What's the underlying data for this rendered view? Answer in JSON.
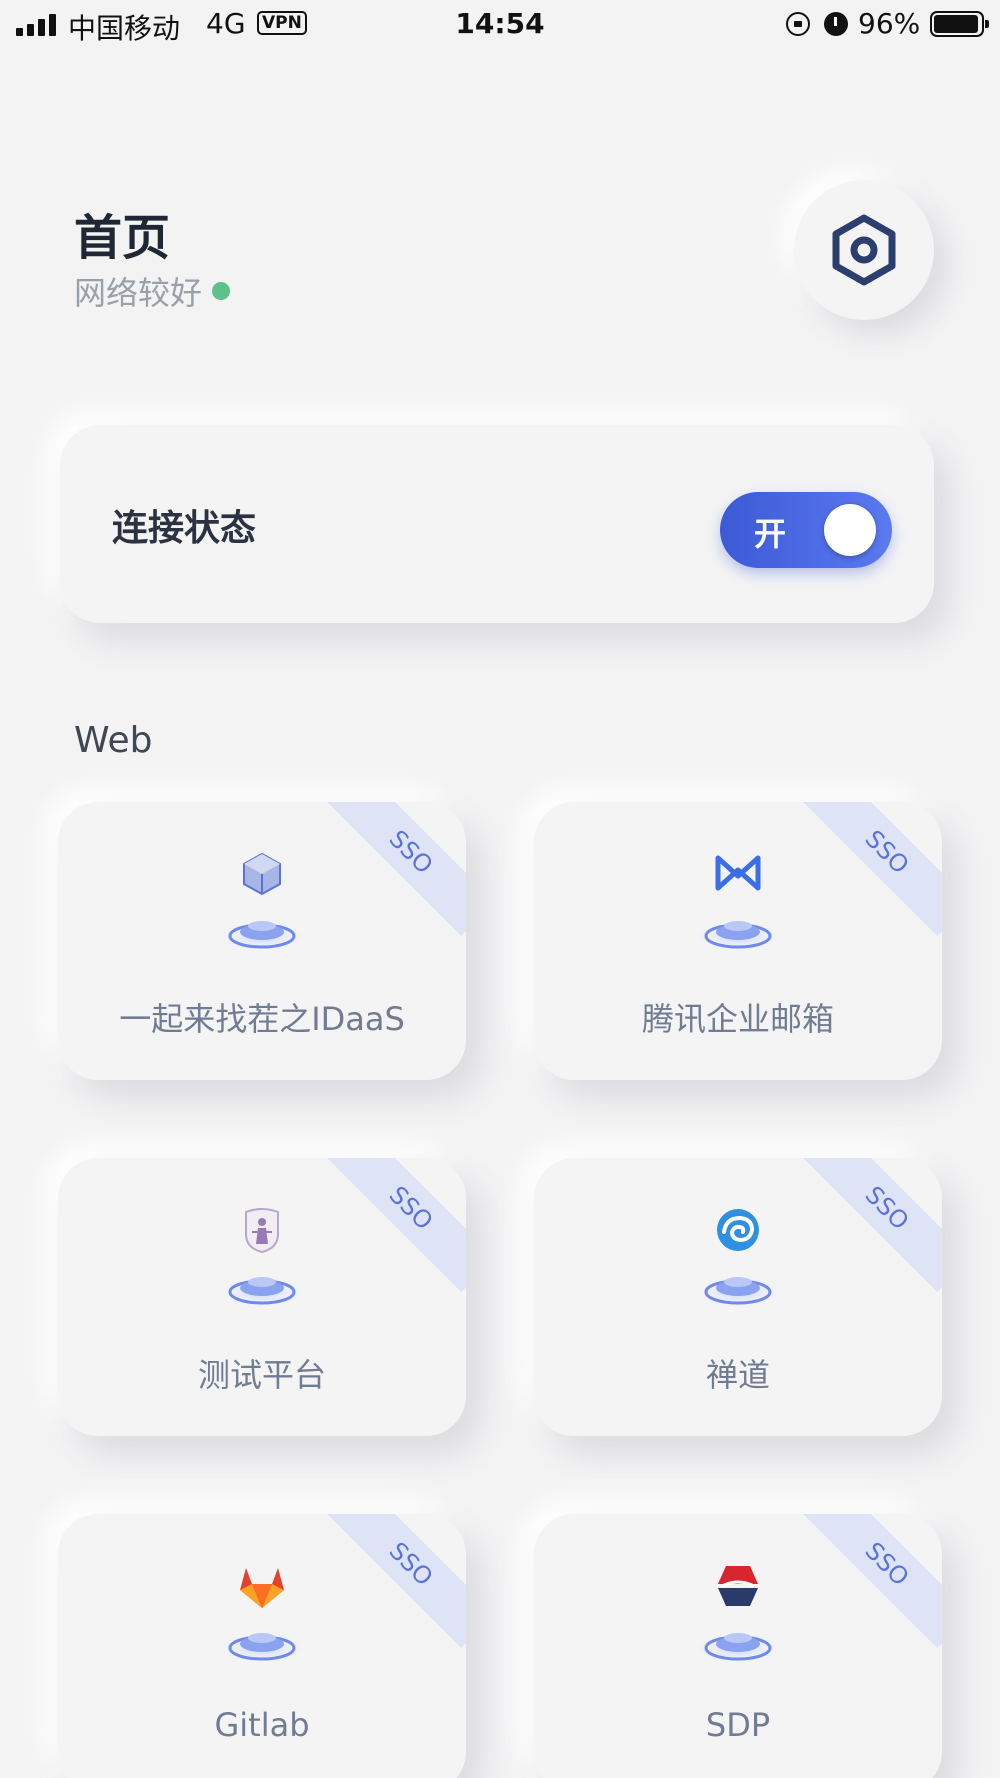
{
  "status_bar": {
    "carrier": "中国移动",
    "network_type": "4G",
    "vpn_label": "VPN",
    "time": "14:54",
    "battery_percent": "96%",
    "battery_level": 0.96
  },
  "header": {
    "title": "首页",
    "network_status": "网络较好",
    "settings_icon": "hexagon-gear-icon"
  },
  "connection": {
    "label": "连接状态",
    "toggle_text": "开",
    "enabled": true
  },
  "section": {
    "title": "Web"
  },
  "apps": [
    {
      "name": "一起来找茬之IDaaS",
      "badge": "SSO",
      "icon": "cube-icon"
    },
    {
      "name": "腾讯企业邮箱",
      "badge": "SSO",
      "icon": "tencent-mail-icon"
    },
    {
      "name": "测试平台",
      "badge": "SSO",
      "icon": "justice-shield-icon"
    },
    {
      "name": "禅道",
      "badge": "SSO",
      "icon": "zentao-swirl-icon"
    },
    {
      "name": "Gitlab",
      "badge": "SSO",
      "icon": "gitlab-fox-icon"
    },
    {
      "name": "SDP",
      "badge": "SSO",
      "icon": "sdp-logo-icon"
    }
  ],
  "colors": {
    "background": "#f3f3f4",
    "accent": "#4664e0",
    "online_dot": "#5ec08a",
    "sso_badge": "#dfe3f6"
  }
}
